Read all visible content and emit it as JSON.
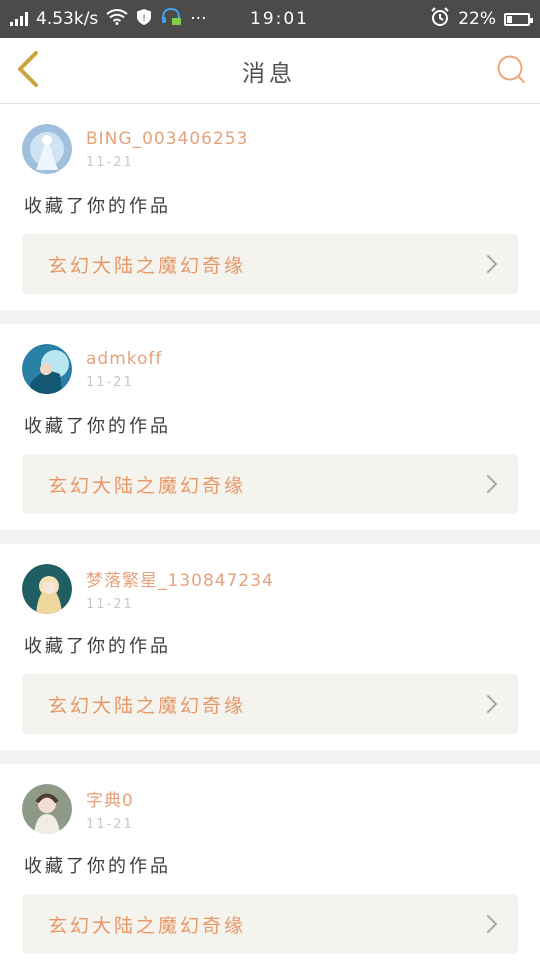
{
  "status_bar": {
    "speed": "4.53k/s",
    "time": "19:01",
    "battery": "22%",
    "battery_level": 0.22,
    "more": "···"
  },
  "header": {
    "title": "消息"
  },
  "colors": {
    "accent": "#e89766",
    "username": "#e5a27b",
    "back": "#c9a63b",
    "search": "#f0a57a"
  },
  "messages": [
    {
      "username": "BING_003406253",
      "date": "11-21",
      "action": "收藏了你的作品",
      "work_title": "玄幻大陆之魔幻奇缘",
      "avatar_icon": "avatar-1"
    },
    {
      "username": "admkoff",
      "date": "11-21",
      "action": "收藏了你的作品",
      "work_title": "玄幻大陆之魔幻奇缘",
      "avatar_icon": "avatar-2"
    },
    {
      "username": "梦落繁星_130847234",
      "date": "11-21",
      "action": "收藏了你的作品",
      "work_title": "玄幻大陆之魔幻奇缘",
      "avatar_icon": "avatar-3"
    },
    {
      "username": "字典0",
      "date": "11-21",
      "action": "收藏了你的作品",
      "work_title": "玄幻大陆之魔幻奇缘",
      "avatar_icon": "avatar-4"
    }
  ]
}
